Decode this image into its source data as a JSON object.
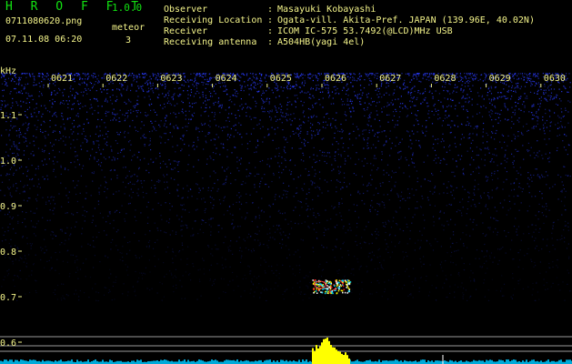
{
  "header": {
    "app_title": "H R O F F T",
    "app_version": "1.0.0",
    "file_name": "0711080620.png",
    "date_time": "07.11.08 06:20",
    "meteor_label": "meteor",
    "meteor_count": "3"
  },
  "info": [
    {
      "label": "Observer",
      "value": "Masayuki Kobayashi"
    },
    {
      "label": "Receiving Location",
      "value": "Ogata-vill. Akita-Pref. JAPAN (139.96E, 40.02N)"
    },
    {
      "label": "Receiver",
      "value": "ICOM IC-575 53.7492(@LCD)MHz USB"
    },
    {
      "label": "Receiving antenna",
      "value": "A504HB(yagi 4el)"
    }
  ],
  "spectrogram": {
    "unit_label": "kHz",
    "time_ticks": [
      "0621",
      "0622",
      "0623",
      "0624",
      "0625",
      "0626",
      "0627",
      "0628",
      "0629",
      "0630"
    ],
    "freq_ticks": [
      "1.1",
      "1.0",
      "0.9",
      "0.8",
      "0.7",
      "0.6"
    ],
    "noise_color": "#2a3cff",
    "echo_colors": [
      "#ffffff",
      "#ff2020",
      "#00e0ff",
      "#ffff00"
    ],
    "baseline_color": "#00c8ff",
    "peak_color": "#ffff00"
  }
}
